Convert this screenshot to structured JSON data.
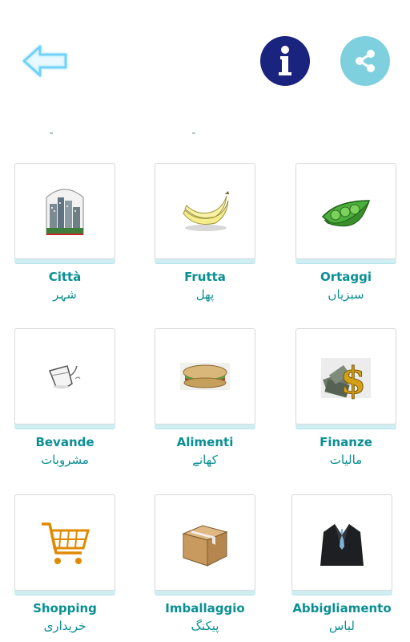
{
  "header": {
    "back_icon": "back-arrow-icon",
    "info_icon": "info-icon",
    "share_icon": "share-icon",
    "info_color": "#1a237e",
    "share_color": "#7fd0de"
  },
  "categories": [
    {
      "italian": "Città",
      "urdu": "شہر",
      "icon": "city-icon"
    },
    {
      "italian": "Frutta",
      "urdu": "پھل",
      "icon": "banana-icon"
    },
    {
      "italian": "Ortaggi",
      "urdu": "سبزیاں",
      "icon": "peas-icon"
    },
    {
      "italian": "Bevande",
      "urdu": "مشروبات",
      "icon": "drink-glass-icon"
    },
    {
      "italian": "Alimenti",
      "urdu": "کھانے",
      "icon": "sandwich-icon"
    },
    {
      "italian": "Finanze",
      "urdu": "مالیات",
      "icon": "money-icon"
    },
    {
      "italian": "Shopping",
      "urdu": "خریداری",
      "icon": "shopping-cart-icon"
    },
    {
      "italian": "Imballaggio",
      "urdu": "پیکنگ",
      "icon": "box-icon"
    },
    {
      "italian": "Abbigliamento",
      "urdu": "لباس",
      "icon": "suit-icon"
    }
  ],
  "accent_color": "#0a8f93"
}
